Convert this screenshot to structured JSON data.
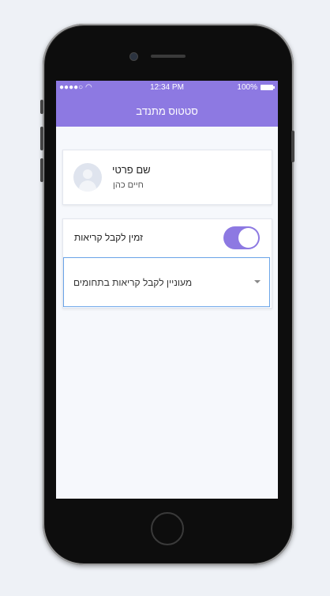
{
  "status_bar": {
    "carrier": "●●●●○ ",
    "time": "12:34 PM",
    "battery": "100%"
  },
  "nav": {
    "title": "סטטוס מתנדב"
  },
  "profile": {
    "title": "שם פרטי",
    "name": "חיים כהן",
    "avatar_icon": "user-placeholder-icon"
  },
  "availability": {
    "label": "זמין לקבל קריאות",
    "enabled": true
  },
  "fields_select": {
    "label": "מעוניין לקבל קריאות בתחומים"
  },
  "colors": {
    "accent": "#8d79e2",
    "select_border": "#6aa4e8",
    "background": "#f6f8fc"
  }
}
